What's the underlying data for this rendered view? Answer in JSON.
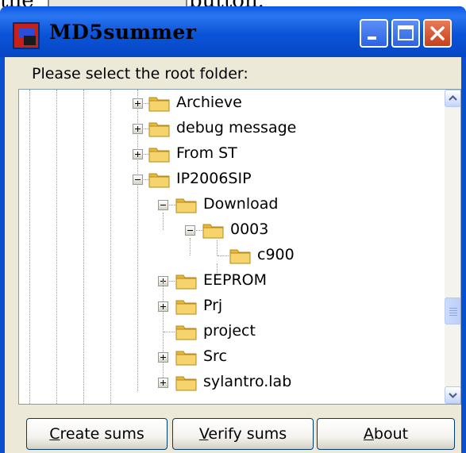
{
  "caption": {
    "before": "the",
    "after": "button."
  },
  "window": {
    "title": "MD5summer",
    "minimize": "minimize-icon",
    "maximize": "maximize-icon",
    "close": "close-icon"
  },
  "prompt": "Please select the root folder:",
  "tree": {
    "items": [
      {
        "label": "Archieve",
        "state": "collapsed"
      },
      {
        "label": "debug message",
        "state": "collapsed"
      },
      {
        "label": "From ST",
        "state": "collapsed"
      },
      {
        "label": "IP2006SIP",
        "state": "expanded"
      },
      {
        "label": "Download",
        "state": "expanded"
      },
      {
        "label": "0003",
        "state": "expanded"
      },
      {
        "label": "c900",
        "state": "leaf"
      },
      {
        "label": "EEPROM",
        "state": "collapsed"
      },
      {
        "label": "Prj",
        "state": "collapsed"
      },
      {
        "label": "project",
        "state": "leaf"
      },
      {
        "label": "Src",
        "state": "collapsed"
      },
      {
        "label": "sylantro.lab",
        "state": "collapsed"
      }
    ]
  },
  "buttons": {
    "create": {
      "mnemonic": "C",
      "rest": "reate sums"
    },
    "verify": {
      "mnemonic": "V",
      "rest": "erify sums"
    },
    "about": {
      "mnemonic": "A",
      "rest": "bout"
    }
  },
  "colors": {
    "title_bar": "#0b54d7",
    "face": "#ece9d8",
    "folder": "#f7d46b"
  }
}
